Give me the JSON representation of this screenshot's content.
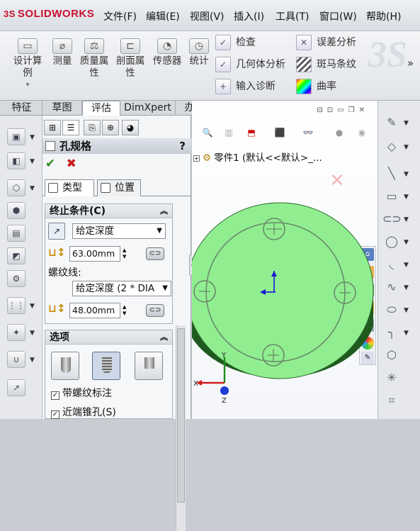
{
  "app": {
    "logo_prefix": "3S",
    "logo_text": "SOLIDWORKS"
  },
  "menu": [
    "文件(F)",
    "编辑(E)",
    "视图(V)",
    "插入(I)",
    "工具(T)",
    "窗口(W)",
    "帮助(H)"
  ],
  "ribbon": {
    "big_buttons": [
      {
        "line1": "设计算",
        "line2": "例",
        "icon": "design-study-icon"
      },
      {
        "line1": "测量",
        "line2": "",
        "icon": "measure-icon"
      },
      {
        "line1": "质量属",
        "line2": "性",
        "icon": "mass-properties-icon"
      },
      {
        "line1": "剖面属",
        "line2": "性",
        "icon": "section-properties-icon"
      },
      {
        "line1": "传感器",
        "line2": "",
        "icon": "sensor-icon"
      },
      {
        "line1": "统计",
        "line2": "",
        "icon": "statistics-icon"
      }
    ],
    "small_col1": [
      "检查",
      "几何体分析",
      "输入诊断"
    ],
    "small_col2": [
      "误差分析",
      "斑马条纹",
      "曲率"
    ],
    "expand": "»"
  },
  "tabs": [
    "特征",
    "草图",
    "评估",
    "DimXpert",
    "办公室产品"
  ],
  "active_tab": "评估",
  "property_manager": {
    "title": "孔规格",
    "help": "?",
    "ok": "✔",
    "cancel": "✖",
    "subtab_type": "类型",
    "subtab_position": "位置",
    "end_condition": {
      "header": "终止条件(C)",
      "condition": "给定深度",
      "depth": "63.00mm",
      "thread_label": "螺纹线:",
      "thread_condition": "给定深度 (2 * DIA",
      "thread_depth": "48.00mm"
    },
    "options": {
      "header": "选项",
      "checkbox1": "带螺纹标注",
      "checkbox2": "近端锥孔(S)",
      "checkbox1_checked": true,
      "checkbox2_checked": true
    }
  },
  "viewport": {
    "tree_item": "零件1 (默认<<默认>_...",
    "axis_x": "X",
    "axis_y": "Y",
    "axis_z": "Z",
    "model_color": "#90ee90"
  }
}
